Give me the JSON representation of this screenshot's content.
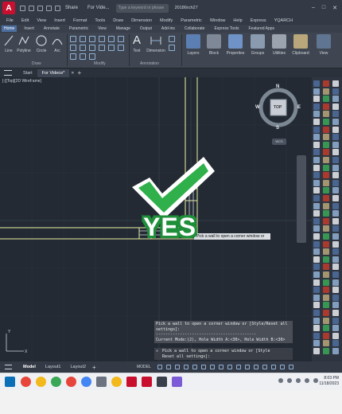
{
  "titlebar": {
    "share": "Share",
    "title": "For Vide...",
    "search_placeholder": "Type a keyword or phrase",
    "user": "20186rch27",
    "logo": "A"
  },
  "menu": [
    "File",
    "Edit",
    "View",
    "Insert",
    "Format",
    "Tools",
    "Draw",
    "Dimension",
    "Modify",
    "Parametric",
    "Window",
    "Help",
    "Express",
    "YQARCH"
  ],
  "ribbon_tabs": [
    {
      "label": "Home",
      "active": true
    },
    {
      "label": "Insert",
      "active": false
    },
    {
      "label": "Annotate",
      "active": false
    },
    {
      "label": "Parametric",
      "active": false
    },
    {
      "label": "View",
      "active": false
    },
    {
      "label": "Manage",
      "active": false
    },
    {
      "label": "Output",
      "active": false
    },
    {
      "label": "Add-ins",
      "active": false
    },
    {
      "label": "Collaborate",
      "active": false
    },
    {
      "label": "Express Tools",
      "active": false
    },
    {
      "label": "Featured Apps",
      "active": false
    }
  ],
  "ribbon": {
    "draw_tools": [
      "Line",
      "Polyline",
      "Circle",
      "Arc"
    ],
    "text_tool": "Text",
    "dimension_tool": "Dimension",
    "big_tools": [
      "Layers",
      "Block",
      "Properties",
      "Groups",
      "Utilities",
      "Clipboard",
      "View"
    ],
    "panels": {
      "draw": "Draw",
      "modify": "Modify",
      "annotation": "Annotation"
    }
  },
  "file_tabs": [
    {
      "label": "Start",
      "active": false
    },
    {
      "label": "For Videos*",
      "active": true
    }
  ],
  "canvas": {
    "view_label": "[-][Top][2D Wireframe]",
    "viewcube": {
      "top": "TOP",
      "n": "N",
      "s": "S",
      "e": "E",
      "w": "W",
      "wcs": "WCS"
    },
    "prompt_tip": "Pick a wall to open a corner window or",
    "history": [
      "Pick a wall to open a corner window or [Style/Reset all",
      "settings]:",
      "------------------------------------------",
      "Current Mode:(2), Hole Width A:<30>, Hole Width B:<30>"
    ],
    "command": [
      "Pick a wall to open a corner window or [Style",
      "Reset all settings]:"
    ],
    "overlay_text": "YES"
  },
  "status": {
    "tabs": [
      {
        "label": "Model",
        "active": true
      },
      {
        "label": "Layout1",
        "active": false
      },
      {
        "label": "Layout2",
        "active": false
      }
    ],
    "model_label": "MODEL"
  },
  "taskbar": {
    "time": "8:03 PM",
    "date": "11/18/2023"
  },
  "colors": {
    "accent_tab": "#4d6fa0",
    "canvas_bg": "#232a33",
    "wall_lines": "#e9f0a0",
    "check_green": "#2fb04a"
  }
}
